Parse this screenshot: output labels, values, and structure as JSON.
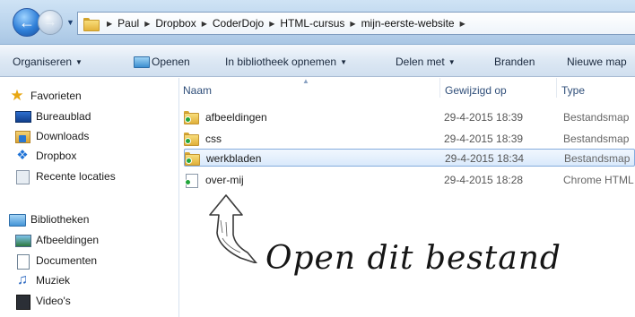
{
  "address": {
    "crumbs": [
      "Paul",
      "Dropbox",
      "CoderDojo",
      "HTML-cursus",
      "mijn-eerste-website"
    ]
  },
  "toolbar": {
    "organize": "Organiseren",
    "open": "Openen",
    "include_library": "In bibliotheek opnemen",
    "share": "Delen met",
    "burn": "Branden",
    "new_folder": "Nieuwe map"
  },
  "nav": {
    "favorites": "Favorieten",
    "desktop": "Bureaublad",
    "downloads": "Downloads",
    "dropbox": "Dropbox",
    "recent": "Recente locaties",
    "libraries": "Bibliotheken",
    "pictures": "Afbeeldingen",
    "documents": "Documenten",
    "music": "Muziek",
    "videos": "Video's"
  },
  "columns": {
    "name": "Naam",
    "modified": "Gewijzigd op",
    "type": "Type"
  },
  "files": [
    {
      "name": "afbeeldingen",
      "date": "29-4-2015 18:39",
      "type": "Bestandsmap",
      "icon": "folder-icon"
    },
    {
      "name": "css",
      "date": "29-4-2015 18:39",
      "type": "Bestandsmap",
      "icon": "folder-icon"
    },
    {
      "name": "werkbladen",
      "date": "29-4-2015 18:34",
      "type": "Bestandsmap",
      "icon": "folder-icon"
    },
    {
      "name": "over-mij",
      "date": "29-4-2015 18:28",
      "type": "Chrome HTML",
      "icon": "html-file-icon"
    }
  ],
  "annotation": {
    "text": "Open dit bestand"
  },
  "colors": {
    "selection_border": "#84acdd",
    "toolbar_bg": "#dde8f4",
    "column_header": "#2f4e79"
  }
}
